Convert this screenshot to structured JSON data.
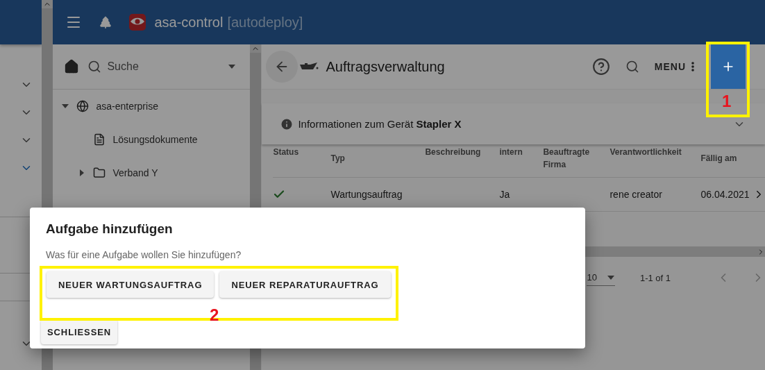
{
  "app_bar": {
    "title": "asa-control",
    "subtitle": "[autodeploy]"
  },
  "left_rail": {
    "expanders": [
      {
        "selected": false
      },
      {
        "selected": false
      },
      {
        "selected": false
      },
      {
        "selected": true
      },
      {
        "selected": false
      }
    ]
  },
  "tree": {
    "search_placeholder": "Suche",
    "items": [
      {
        "label": "asa-enterprise",
        "kind": "globe",
        "expanded": true,
        "children": [
          {
            "label": "Lösungsdokumente",
            "kind": "document"
          },
          {
            "label": "Verband Y",
            "kind": "folder",
            "expanded": false
          }
        ]
      }
    ]
  },
  "page": {
    "title": "Auftragsverwaltung",
    "menu_label": "MENU",
    "info": "Informationen zum Gerät **Stapler X**"
  },
  "table": {
    "columns": [
      "Status",
      "Typ",
      "Beschreibung",
      "intern",
      "Beauftragte Firma",
      "Verantwortlichkeit",
      "Fällig am"
    ],
    "rows": [
      {
        "done": true,
        "cells": [
          "",
          "Wartungsauftrag",
          "",
          "Ja",
          "",
          "rene creator",
          "06.04.2021"
        ]
      }
    ]
  },
  "pagination": {
    "rows_per_page": "10",
    "range": "1-1 of 1"
  },
  "dialog": {
    "title": "Aufgabe hinzufügen",
    "text": "Was für eine Aufgabe wollen Sie hinzufügen?",
    "options": [
      "NEUER WARTUNGSAUFTRAG",
      "NEUER REPARATURAUFTRAG"
    ],
    "close": "SCHLIESSEN"
  },
  "annotations": [
    {
      "label": "1"
    },
    {
      "label": "2"
    }
  ]
}
